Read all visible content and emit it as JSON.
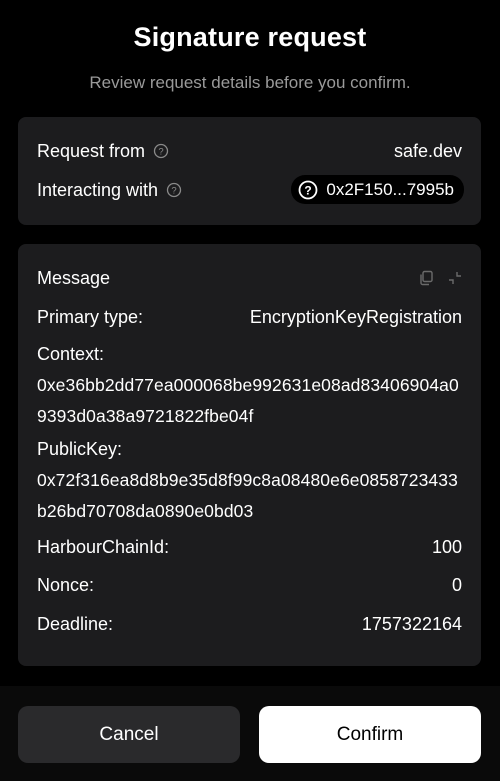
{
  "header": {
    "title": "Signature request",
    "subtitle": "Review request details before you confirm."
  },
  "request": {
    "from_label": "Request from",
    "from_value": "safe.dev",
    "interacting_label": "Interacting with",
    "interacting_value": "0x2F150...7995b"
  },
  "message": {
    "title": "Message",
    "primary_type_label": "Primary type:",
    "primary_type_value": "EncryptionKeyRegistration",
    "context_label": "Context:",
    "context_value": "0xe36bb2dd77ea000068be992631e08ad83406904a09393d0a38a9721822fbe04f",
    "publickey_label": "PublicKey:",
    "publickey_value": "0x72f316ea8d8b9e35d8f99c8a08480e6e0858723433b26bd70708da0890e0bd03",
    "chainid_label": "HarbourChainId:",
    "chainid_value": "100",
    "nonce_label": "Nonce:",
    "nonce_value": "0",
    "deadline_label": "Deadline:",
    "deadline_value": "1757322164"
  },
  "actions": {
    "cancel_label": "Cancel",
    "confirm_label": "Confirm"
  },
  "icons": {
    "info": "info-circle-icon",
    "question": "question-circle-icon",
    "copy": "copy-icon",
    "collapse": "collapse-icon"
  },
  "colors": {
    "background": "#000000",
    "card": "#1c1c1e",
    "muted_text": "#9a9a9a",
    "cancel_button": "#2a2a2c",
    "confirm_button": "#ffffff"
  }
}
